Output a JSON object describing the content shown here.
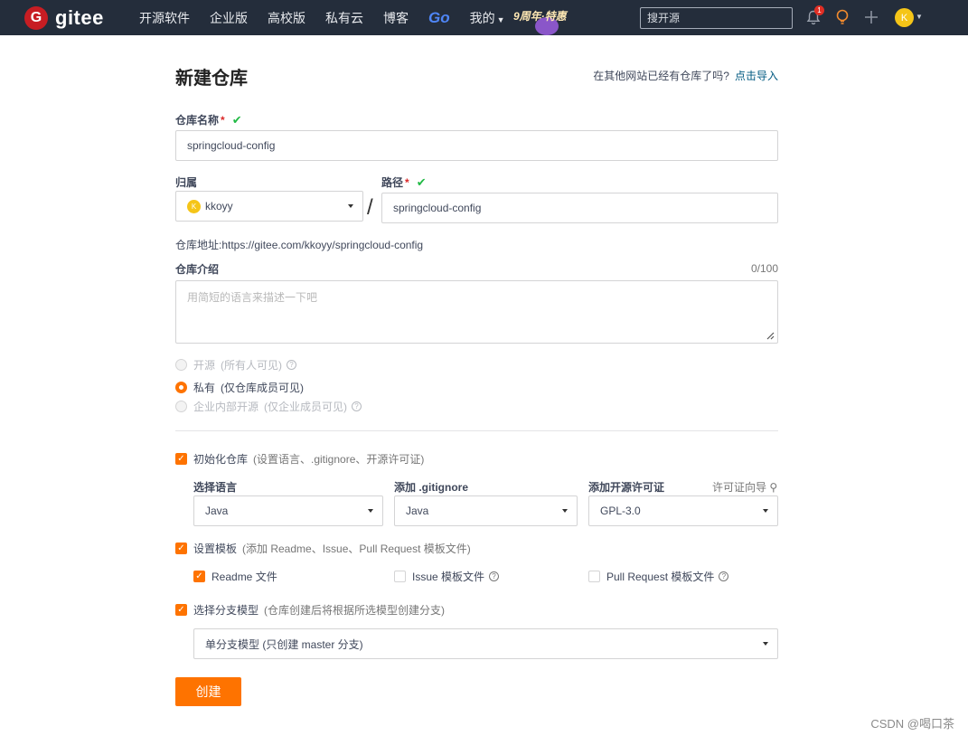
{
  "nav": {
    "logo_glyph": "G",
    "logo_text": "gitee",
    "items": [
      "开源软件",
      "企业版",
      "高校版",
      "私有云",
      "博客"
    ],
    "go_label": "Go",
    "mine_label": "我的",
    "promo_text": "9周年·特惠",
    "search_placeholder": "搜开源",
    "notification_count": "1",
    "avatar_initial": "K"
  },
  "form": {
    "title": "新建仓库",
    "import_prompt": "在其他网站已经有仓库了吗?",
    "import_link": "点击导入",
    "repo_name_label": "仓库名称",
    "required_mark": "*",
    "repo_name_value": "springcloud-config",
    "owner_label": "归属",
    "owner_initial": "K",
    "owner_value": "kkoyy",
    "slash": "/",
    "path_label": "路径",
    "path_value": "springcloud-config",
    "address_text": "仓库地址:https://gitee.com/kkoyy/springcloud-config",
    "intro_label": "仓库介绍",
    "intro_counter": "0/100",
    "intro_placeholder": "用简短的语言来描述一下吧",
    "visibility": [
      {
        "label": "开源",
        "hint": "(所有人可见)",
        "selected": false,
        "disabled": true
      },
      {
        "label": "私有",
        "hint": "(仅仓库成员可见)",
        "selected": true,
        "disabled": false
      },
      {
        "label": "企业内部开源",
        "hint": "(仅企业成员可见)",
        "selected": false,
        "disabled": true
      }
    ],
    "init_repo": {
      "label": "初始化仓库",
      "hint": "(设置语言、.gitignore、开源许可证)",
      "checked": true
    },
    "language_label": "选择语言",
    "language_value": "Java",
    "gitignore_label": "添加 .gitignore",
    "gitignore_value": "Java",
    "license_label": "添加开源许可证",
    "license_guide": "许可证向导",
    "license_value": "GPL-3.0",
    "template": {
      "label": "设置模板",
      "hint": "(添加 Readme、Issue、Pull Request 模板文件)",
      "checked": true
    },
    "template_options": [
      {
        "label": "Readme 文件",
        "checked": true
      },
      {
        "label": "Issue 模板文件",
        "checked": false
      },
      {
        "label": "Pull Request 模板文件",
        "checked": false
      }
    ],
    "branch": {
      "label": "选择分支模型",
      "hint": "(仓库创建后将根据所选模型创建分支)",
      "checked": true
    },
    "branch_value": "单分支模型 (只创建 master 分支)",
    "create_button": "创建"
  },
  "watermark": "CSDN @喝口茶",
  "colors": {
    "accent": "#fe7300",
    "topbar": "#242d3b",
    "success": "#21ba45",
    "required": "#db2828"
  }
}
